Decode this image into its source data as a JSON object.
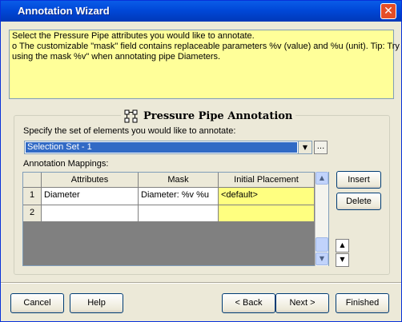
{
  "window": {
    "title": "Annotation Wizard"
  },
  "info": {
    "lines": [
      "Select the Pressure Pipe attributes you would like to annotate.",
      "o  The customizable \"mask\" field contains replaceable parameters %v (value) and %u (unit).  Tip: Try",
      "using the mask  %v\"  when annotating pipe Diameters."
    ]
  },
  "group": {
    "title": "Pressure Pipe Annotation",
    "specify_label": "Specify the set of elements you would like to annotate:",
    "selection_value": "Selection Set - 1",
    "ellipsis_label": "...",
    "mappings_label": "Annotation Mappings:"
  },
  "grid": {
    "columns": [
      "Attributes",
      "Mask",
      "Initial Placement"
    ],
    "rows": [
      {
        "num": "1",
        "attribute": "Diameter",
        "mask": "Diameter: %v %u",
        "placement": "<default>"
      },
      {
        "num": "2",
        "attribute": "",
        "mask": "",
        "placement": ""
      }
    ]
  },
  "buttons": {
    "insert": "Insert",
    "delete": "Delete",
    "cancel": "Cancel",
    "help": "Help",
    "back": "< Back",
    "next": "Next >",
    "finished": "Finished"
  },
  "icons": {
    "close": "close-icon",
    "group": "pipe-network-icon",
    "dropdown": "chevron-down-icon",
    "scroll_up": "chevron-up-icon",
    "scroll_down": "chevron-down-icon",
    "move_up": "arrow-up-icon",
    "move_down": "arrow-down-icon"
  },
  "colors": {
    "titlebar": "#0054e3",
    "info_background": "#ffff99",
    "placement_cells": "#ffff80",
    "selection_highlight": "#316ac5"
  }
}
